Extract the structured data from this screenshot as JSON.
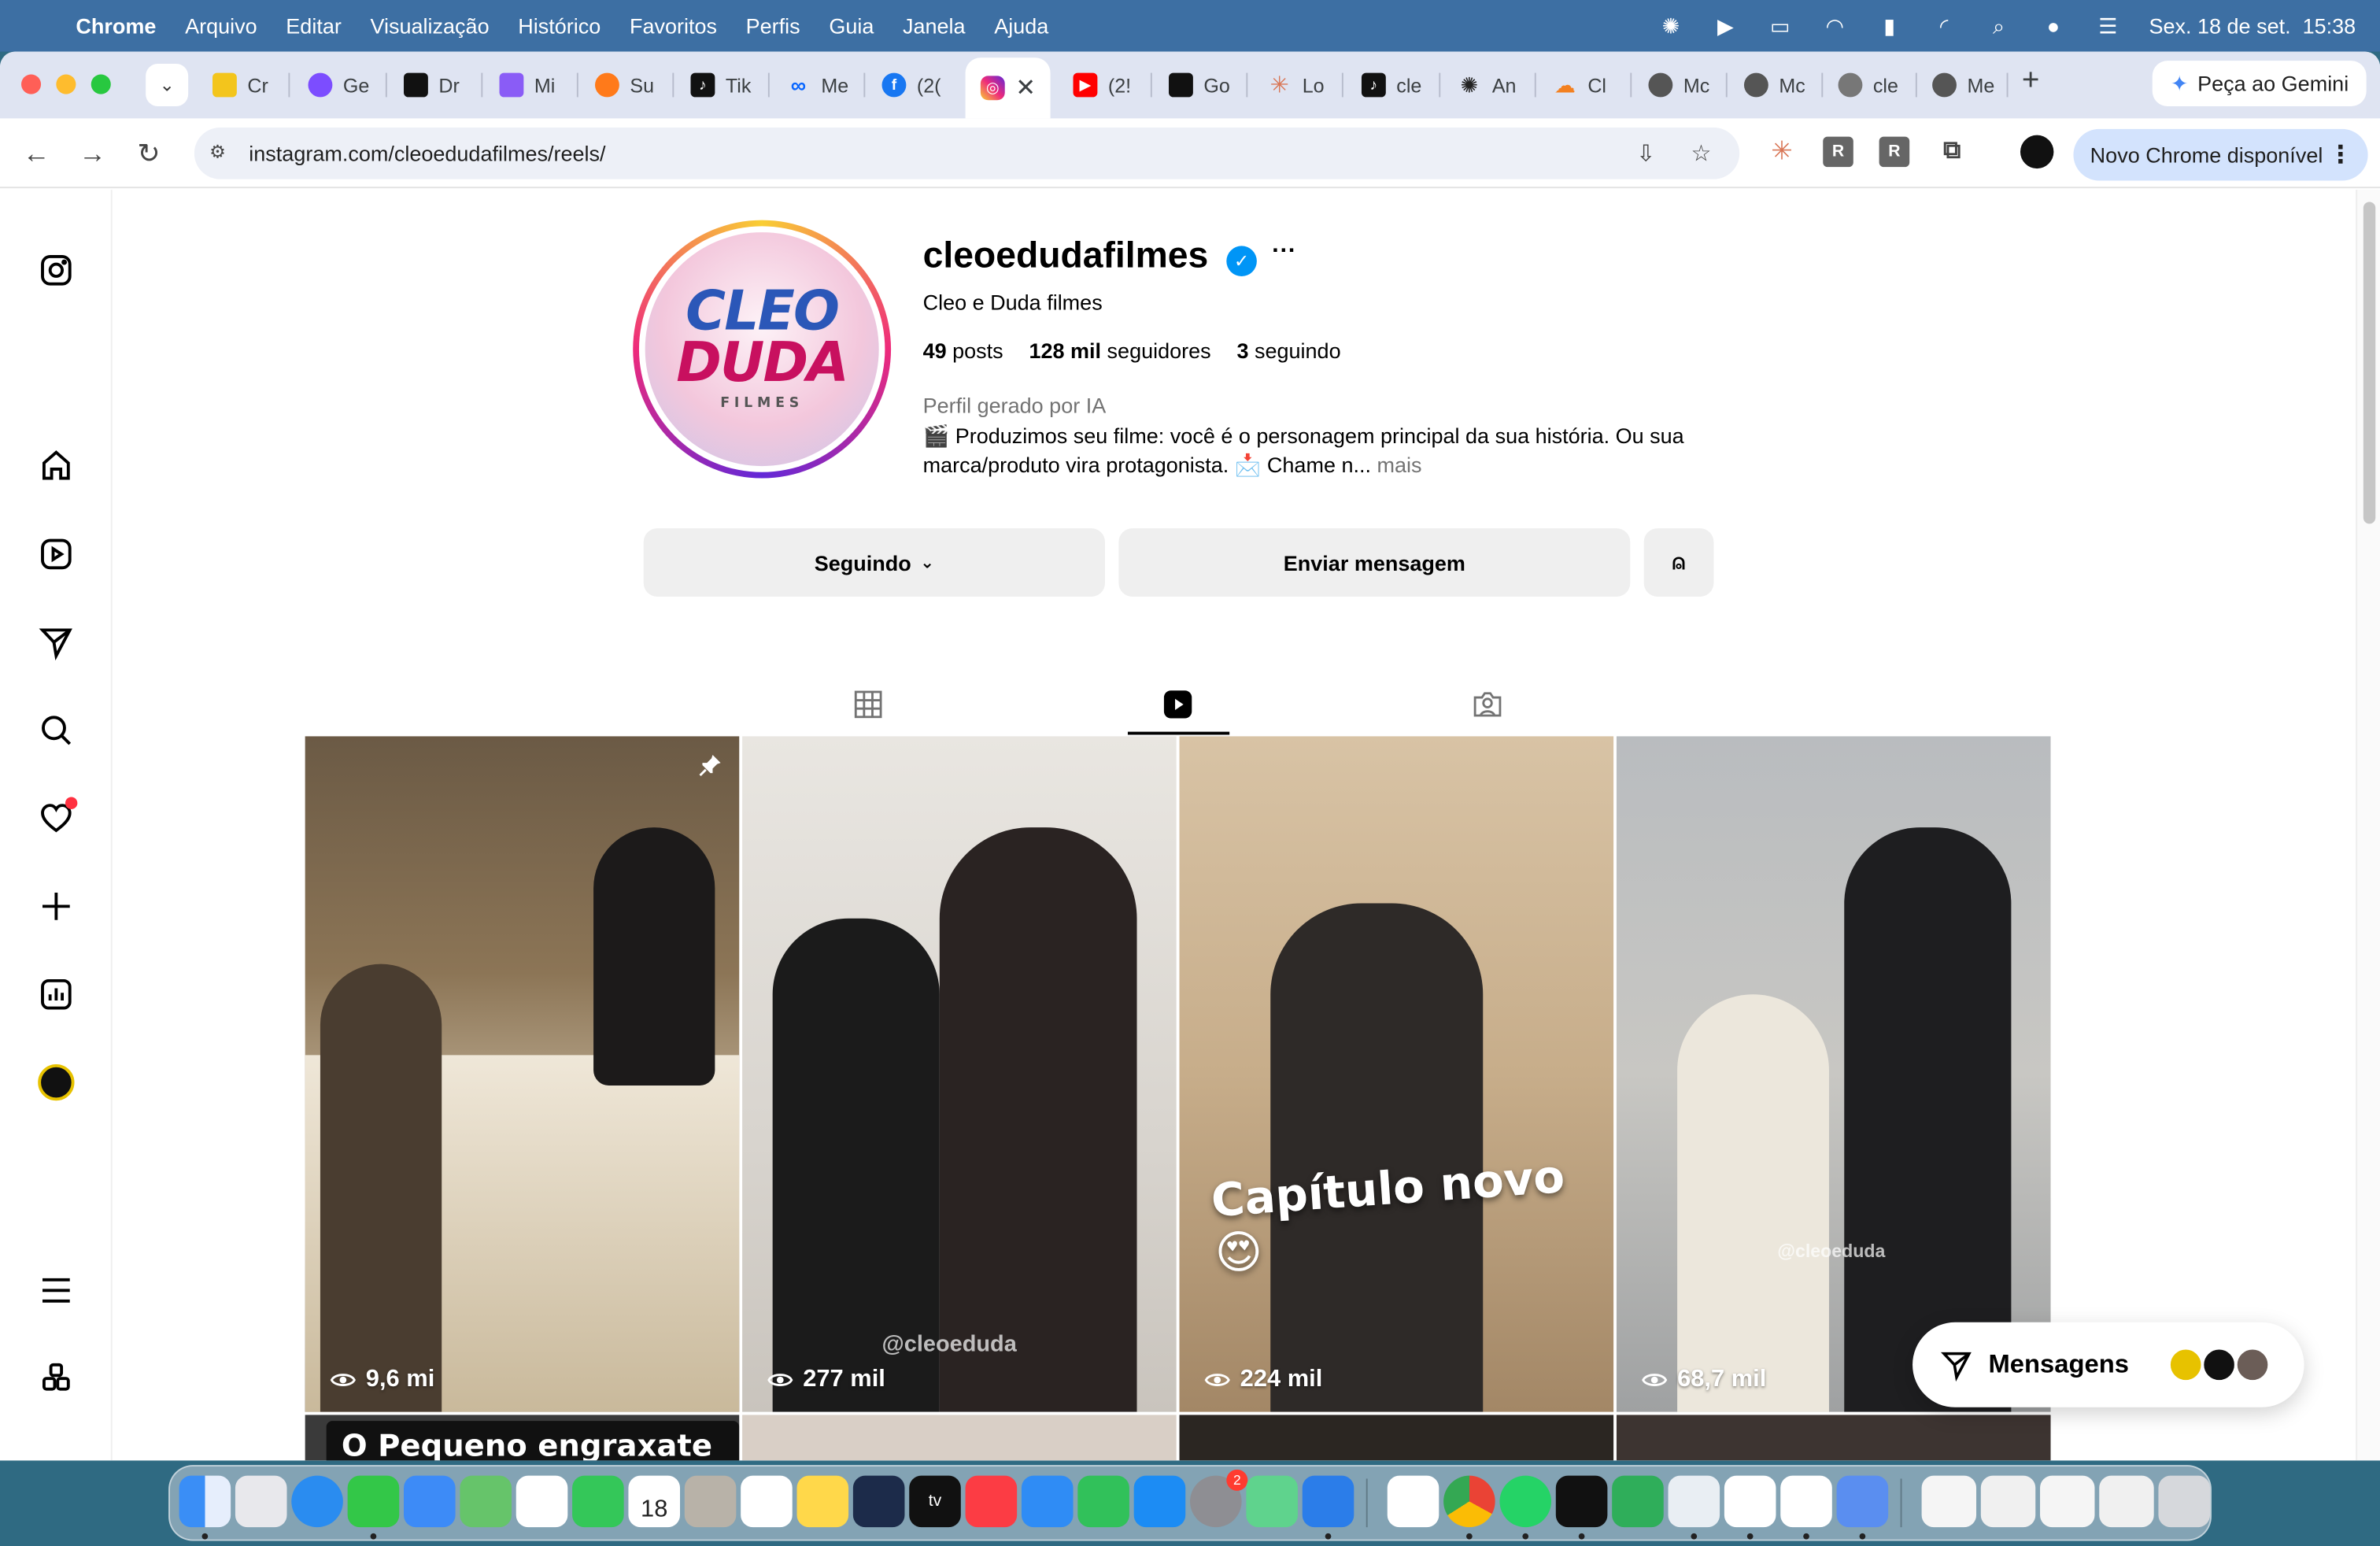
{
  "menubar": {
    "app": "Chrome",
    "items": [
      "Arquivo",
      "Editar",
      "Visualização",
      "Histórico",
      "Favoritos",
      "Perfis",
      "Guia",
      "Janela",
      "Ajuda"
    ],
    "datetime": "Sex. 18 de set.  15:38"
  },
  "tabs": [
    {
      "label": "Cr",
      "color": "#f3c51c"
    },
    {
      "label": "Ge",
      "color": "#7c4dff"
    },
    {
      "label": "Dr",
      "color": "#111111"
    },
    {
      "label": "Mi",
      "color": "#8a5cf6"
    },
    {
      "label": "Su",
      "color": "#ff7a1a"
    },
    {
      "label": "Tik",
      "color": "#111111"
    },
    {
      "label": "Me",
      "color": "#0866ff"
    },
    {
      "label": "(2(",
      "color": "#1877f2"
    },
    {
      "label": "(2!",
      "color": "#ff0000"
    },
    {
      "label": "Go",
      "color": "#111111"
    },
    {
      "label": "Lo",
      "color": "#d97757"
    },
    {
      "label": "cle",
      "color": "#111111"
    },
    {
      "label": "An",
      "color": "#222222"
    },
    {
      "label": "Cl",
      "color": "#f38020"
    },
    {
      "label": "Mc",
      "color": "#555555"
    },
    {
      "label": "Mc",
      "color": "#555555"
    },
    {
      "label": "cle",
      "color": "#555555"
    },
    {
      "label": "Me",
      "color": "#555555"
    }
  ],
  "gemini_button": "Peça ao Gemini",
  "address_bar": {
    "url": "instagram.com/cleoedudafilmes/reels/"
  },
  "update_button": "Novo Chrome disponível",
  "profile": {
    "username": "cleoedudafilmes",
    "full_name": "Cleo e Duda filmes",
    "posts_count": "49",
    "posts_label": "posts",
    "followers_count": "128 mil",
    "followers_label": "seguidores",
    "following_count": "3",
    "following_label": "seguindo",
    "ai_label": "Perfil gerado por IA",
    "bio": "🎬 Produzimos seu filme: você é o personagem principal da sua história. Ou sua marca/produto vira protagonista. 📩 Chame n...",
    "bio_more": "mais",
    "logo_line1": "CLEO",
    "logo_line2": "DUDA",
    "logo_line3": "FILMES"
  },
  "actions": {
    "following_button": "Seguindo",
    "message_button": "Enviar mensagem"
  },
  "reels": [
    {
      "views": "9,6 mi",
      "pinned": true
    },
    {
      "views": "277 mil",
      "watermark": "@cleoeduda"
    },
    {
      "views": "224 mil",
      "overlay": "Capítulo novo😍"
    },
    {
      "views": "68,7 mil",
      "watermark": "@cleoeduda"
    }
  ],
  "next_row_caption": "O Pequeno engraxate /",
  "messages_pill": "Mensagens",
  "dock": {
    "calendar_day": "18",
    "settings_badge": "2"
  }
}
